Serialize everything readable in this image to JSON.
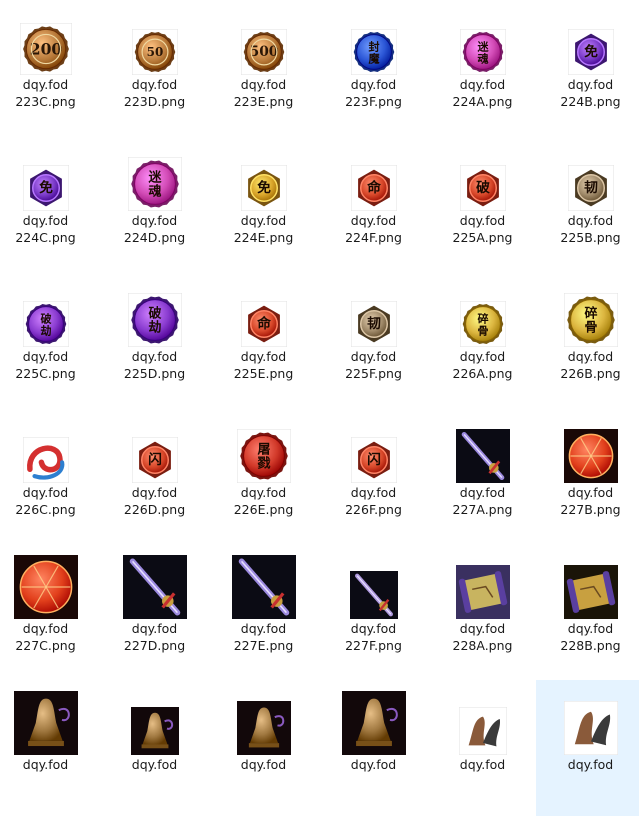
{
  "files": [
    {
      "l1": "dqy.fod",
      "l2": "223C.png",
      "kind": "coin",
      "color": "#b87a3a",
      "rim": "#6d3f17",
      "text": "200",
      "w": 52
    },
    {
      "l1": "dqy.fod",
      "l2": "223D.png",
      "kind": "coin",
      "color": "#b87a3a",
      "rim": "#6d3f17",
      "text": "50",
      "w": 46
    },
    {
      "l1": "dqy.fod",
      "l2": "223E.png",
      "kind": "coin",
      "color": "#b87a3a",
      "rim": "#6d3f17",
      "text": "500",
      "w": 46
    },
    {
      "l1": "dqy.fod",
      "l2": "223F.png",
      "kind": "coin",
      "color": "#2b56d6",
      "rim": "#152f80",
      "text": "封魔",
      "w": 46
    },
    {
      "l1": "dqy.fod",
      "l2": "224A.png",
      "kind": "coin",
      "color": "#d24bb6",
      "rim": "#7a1f68",
      "text": "迷魂",
      "w": 46
    },
    {
      "l1": "dqy.fod",
      "l2": "224B.png",
      "kind": "hex",
      "color": "#7b3bc9",
      "rim": "#3c1670",
      "text": "免",
      "w": 46
    },
    {
      "l1": "dqy.fod",
      "l2": "224C.png",
      "kind": "hex",
      "color": "#7b3bc9",
      "rim": "#3c1670",
      "text": "免",
      "w": 46
    },
    {
      "l1": "dqy.fod",
      "l2": "224D.png",
      "kind": "coin",
      "color": "#d24bb6",
      "rim": "#7a1f68",
      "text": "迷魂",
      "w": 54
    },
    {
      "l1": "dqy.fod",
      "l2": "224E.png",
      "kind": "hex",
      "color": "#d9a52a",
      "rim": "#7a5510",
      "text": "免",
      "w": 46
    },
    {
      "l1": "dqy.fod",
      "l2": "224F.png",
      "kind": "hex",
      "color": "#d8482a",
      "rim": "#7a1d10",
      "text": "命",
      "w": 46
    },
    {
      "l1": "dqy.fod",
      "l2": "225A.png",
      "kind": "hex",
      "color": "#d8482a",
      "rim": "#7a1d10",
      "text": "破",
      "w": 46
    },
    {
      "l1": "dqy.fod",
      "l2": "225B.png",
      "kind": "hex",
      "color": "#a08a6a",
      "rim": "#4a3a22",
      "text": "韧",
      "w": 46
    },
    {
      "l1": "dqy.fod",
      "l2": "225C.png",
      "kind": "coin",
      "color": "#8a3cd0",
      "rim": "#3c1670",
      "text": "破劫",
      "w": 46
    },
    {
      "l1": "dqy.fod",
      "l2": "225D.png",
      "kind": "coin",
      "color": "#8a3cd0",
      "rim": "#3c1670",
      "text": "破劫",
      "w": 54
    },
    {
      "l1": "dqy.fod",
      "l2": "225E.png",
      "kind": "hex",
      "color": "#d8482a",
      "rim": "#7a1d10",
      "text": "命",
      "w": 46
    },
    {
      "l1": "dqy.fod",
      "l2": "225F.png",
      "kind": "hex",
      "color": "#a08a6a",
      "rim": "#4a3a22",
      "text": "韧",
      "w": 46
    },
    {
      "l1": "dqy.fod",
      "l2": "226A.png",
      "kind": "coin",
      "color": "#dcb640",
      "rim": "#7a5c10",
      "text": "碎骨",
      "w": 46
    },
    {
      "l1": "dqy.fod",
      "l2": "226B.png",
      "kind": "coin",
      "color": "#dcb640",
      "rim": "#7a5c10",
      "text": "碎骨",
      "w": 54
    },
    {
      "l1": "dqy.fod",
      "l2": "226C.png",
      "kind": "swirl",
      "color": "#d43030",
      "rim": "#2d7fd0",
      "text": "",
      "w": 46
    },
    {
      "l1": "dqy.fod",
      "l2": "226D.png",
      "kind": "hex",
      "color": "#d8482a",
      "rim": "#7a1d10",
      "text": "闪",
      "w": 46
    },
    {
      "l1": "dqy.fod",
      "l2": "226E.png",
      "kind": "coin",
      "color": "#d23a2a",
      "rim": "#7a1510",
      "text": "屠戮",
      "w": 54
    },
    {
      "l1": "dqy.fod",
      "l2": "226F.png",
      "kind": "hex",
      "color": "#d8482a",
      "rim": "#7a1d10",
      "text": "闪",
      "w": 46
    },
    {
      "l1": "dqy.fod",
      "l2": "227A.png",
      "kind": "spear",
      "color": "#9c8adf",
      "rim": "#0b0b14",
      "text": "",
      "w": 54
    },
    {
      "l1": "dqy.fod",
      "l2": "227B.png",
      "kind": "orb",
      "color": "#e2401c",
      "rim": "#1a0806",
      "text": "",
      "w": 54
    },
    {
      "l1": "dqy.fod",
      "l2": "227C.png",
      "kind": "orb",
      "color": "#e2401c",
      "rim": "#1a0806",
      "text": "",
      "w": 64
    },
    {
      "l1": "dqy.fod",
      "l2": "227D.png",
      "kind": "spear",
      "color": "#9c8adf",
      "rim": "#0b0b14",
      "text": "",
      "w": 64
    },
    {
      "l1": "dqy.fod",
      "l2": "227E.png",
      "kind": "spear",
      "color": "#9c8adf",
      "rim": "#0b0b14",
      "text": "",
      "w": 64
    },
    {
      "l1": "dqy.fod",
      "l2": "227F.png",
      "kind": "spear",
      "color": "#b09adf",
      "rim": "#0b0b14",
      "text": "",
      "w": 48
    },
    {
      "l1": "dqy.fod",
      "l2": "228A.png",
      "kind": "scroll",
      "color": "#c8b460",
      "rim": "#3a3060",
      "text": "",
      "w": 54
    },
    {
      "l1": "dqy.fod",
      "l2": "228B.png",
      "kind": "scroll",
      "color": "#c8a040",
      "rim": "#1a1408",
      "text": "",
      "w": 54
    },
    {
      "l1": "dqy.fod",
      "l2": "",
      "kind": "bell",
      "color": "#a07840",
      "rim": "#12080a",
      "text": "",
      "w": 64
    },
    {
      "l1": "dqy.fod",
      "l2": "",
      "kind": "bell",
      "color": "#a07840",
      "rim": "#12080a",
      "text": "",
      "w": 48
    },
    {
      "l1": "dqy.fod",
      "l2": "",
      "kind": "bell",
      "color": "#a07840",
      "rim": "#12080a",
      "text": "",
      "w": 54
    },
    {
      "l1": "dqy.fod",
      "l2": "",
      "kind": "bell",
      "color": "#a07840",
      "rim": "#12080a",
      "text": "",
      "w": 64
    },
    {
      "l1": "dqy.fod",
      "l2": "",
      "kind": "horn",
      "color": "#8a5a3a",
      "rim": "#ffffff",
      "text": "",
      "w": 48
    },
    {
      "l1": "dqy.fod",
      "l2": "",
      "kind": "horn",
      "color": "#8a5a3a",
      "rim": "#ffffff",
      "text": "",
      "w": 54,
      "selected": true
    }
  ]
}
